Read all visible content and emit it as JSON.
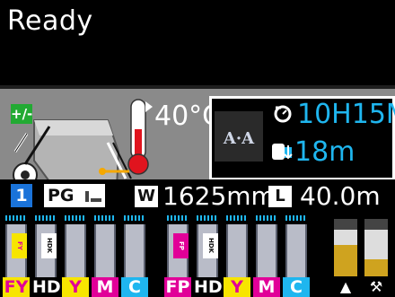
{
  "status": {
    "text": "Ready"
  },
  "heater": {
    "adjust_badge": "+/-",
    "temperature": "40°C"
  },
  "info": {
    "time_left": "10H15M",
    "roll_remaining": "18m",
    "aa_label": "A·A"
  },
  "media": {
    "slot_number": "1",
    "pg_label": "PG",
    "width_label": "W",
    "width_value": "1625mm",
    "length_label": "L",
    "length_value": "40.0m"
  },
  "inks": [
    {
      "label": "FY",
      "sticker": "FY",
      "label_bg": "#f7e500",
      "label_color": "#e10098",
      "sticker_bg": "#f7e500",
      "sticker_color": "#e10098"
    },
    {
      "label": "HDK",
      "sticker": "HDK",
      "label_bg": "#000000",
      "label_color": "#ffffff",
      "sticker_bg": "#ffffff",
      "sticker_color": "#111111"
    },
    {
      "label": "Y",
      "sticker": "",
      "label_bg": "#f7e500",
      "label_color": "#e10098",
      "sticker_bg": "",
      "sticker_color": ""
    },
    {
      "label": "M",
      "sticker": "",
      "label_bg": "#e10098",
      "label_color": "#ffffff",
      "sticker_bg": "",
      "sticker_color": ""
    },
    {
      "label": "C",
      "sticker": "",
      "label_bg": "#1fb6ef",
      "label_color": "#ffffff",
      "sticker_bg": "",
      "sticker_color": ""
    },
    {
      "label": "FP",
      "sticker": "FP",
      "label_bg": "#e10098",
      "label_color": "#ffffff",
      "sticker_bg": "#e10098",
      "sticker_color": "#ffffff"
    },
    {
      "label": "HDK",
      "sticker": "HDK",
      "label_bg": "#000000",
      "label_color": "#ffffff",
      "sticker_bg": "#ffffff",
      "sticker_color": "#111111"
    },
    {
      "label": "Y",
      "sticker": "",
      "label_bg": "#f7e500",
      "label_color": "#e10098",
      "sticker_bg": "",
      "sticker_color": ""
    },
    {
      "label": "M",
      "sticker": "",
      "label_bg": "#e10098",
      "label_color": "#ffffff",
      "sticker_bg": "",
      "sticker_color": ""
    },
    {
      "label": "C",
      "sticker": "",
      "label_bg": "#1fb6ef",
      "label_color": "#ffffff",
      "sticker_bg": "",
      "sticker_color": ""
    }
  ],
  "waste": [
    {
      "icon": "waste-ink-icon",
      "level": 0.55
    },
    {
      "icon": "maintenance-icon",
      "level": 0.3
    }
  ],
  "colors": {
    "accent_cyan": "#1fb6ef",
    "magenta": "#e10098",
    "yellow": "#f7e500",
    "panel_gray": "#8a8a8a"
  }
}
